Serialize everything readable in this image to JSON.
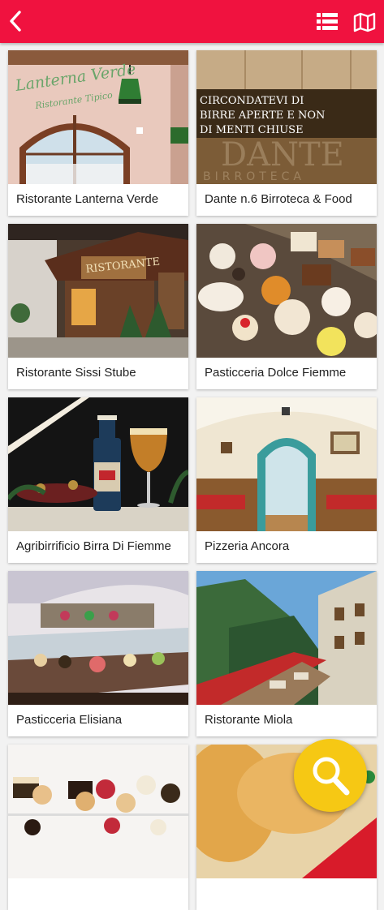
{
  "colors": {
    "accent": "#f0123f",
    "fab": "#f6c814"
  },
  "header": {
    "back_icon": "chevron-left-icon",
    "list_icon": "list-view-icon",
    "map_icon": "map-icon"
  },
  "cards": [
    {
      "title": "Ristorante Lanterna Verde",
      "sign": "Lanterna Verde",
      "sign_sub": "Ristorante Tipico"
    },
    {
      "title": "Dante n.6 Birroteca & Food",
      "sign_lines": [
        "CIRCONDATEVI DI",
        "BIRRE APERTE E NON",
        "DI MENTI CHIUSE"
      ],
      "watermark": "DANTE",
      "watermark_sub": "BIRROTECA"
    },
    {
      "title": "Ristorante Sissi Stube",
      "sign": "RISTORANTE"
    },
    {
      "title": "Pasticceria Dolce Fiemme"
    },
    {
      "title": "Agribirrificio Birra Di Fiemme"
    },
    {
      "title": "Pizzeria Ancora"
    },
    {
      "title": "Pasticceria Elisiana"
    },
    {
      "title": "Ristorante Miola"
    },
    {
      "title": ""
    },
    {
      "title": ""
    }
  ],
  "search_fab": {
    "icon": "search-icon"
  }
}
